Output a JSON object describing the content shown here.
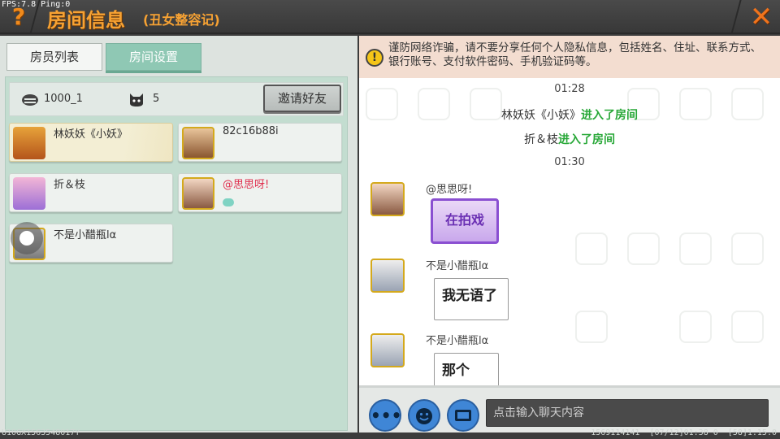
{
  "debug": {
    "fps_ping": "FPS:7.8  Ping:0"
  },
  "header": {
    "help_label": "?",
    "title": "房间信息",
    "subtitle": "(丑女整容记)",
    "close_label": "✕"
  },
  "tabs": [
    {
      "label": "房员列表",
      "active": false
    },
    {
      "label": "房间设置",
      "active": true
    }
  ],
  "room_info": {
    "room_id": "1000_1",
    "player_count": "5",
    "invite_label": "邀请好友"
  },
  "members": [
    {
      "name": "林妖妖《小妖》",
      "owner": true
    },
    {
      "name": "82c16b88i",
      "owner": false
    },
    {
      "name": "折＆枝",
      "owner": false
    },
    {
      "name": "@思思呀!",
      "owner": false
    },
    {
      "name": "不是小醋瓶lα",
      "owner": false
    }
  ],
  "notice": {
    "text": "谨防网络诈骗，请不要分享任何个人隐私信息，包括姓名、住址、联系方式、银行账号、支付软件密码、手机验证码等。"
  },
  "chat": {
    "time1": "01:28",
    "join1_name": "林妖妖《小妖》",
    "join1_action": "进入了房间",
    "join2_name": "折＆枝",
    "join2_action": "进入了房间",
    "time2": "01:30",
    "msg1_name": "@思思呀!",
    "msg1_sticker": "在拍戏",
    "msg2_name": "不是小醋瓶lα",
    "msg2_text": "我无语了",
    "msg3_name": "不是小醋瓶lα",
    "msg3_text": "那个"
  },
  "input": {
    "placeholder": "点击输入聊天内容"
  },
  "footer": {
    "uid": "U10GX1563548017Y",
    "stats": "1569114141  [07/12]01:38 0  [58]1.15.0"
  },
  "colors": {
    "accent": "#f7a233",
    "tab_active": "#8fc8b4",
    "panel_green": "#c3ddd0",
    "join_green": "#28a838"
  }
}
